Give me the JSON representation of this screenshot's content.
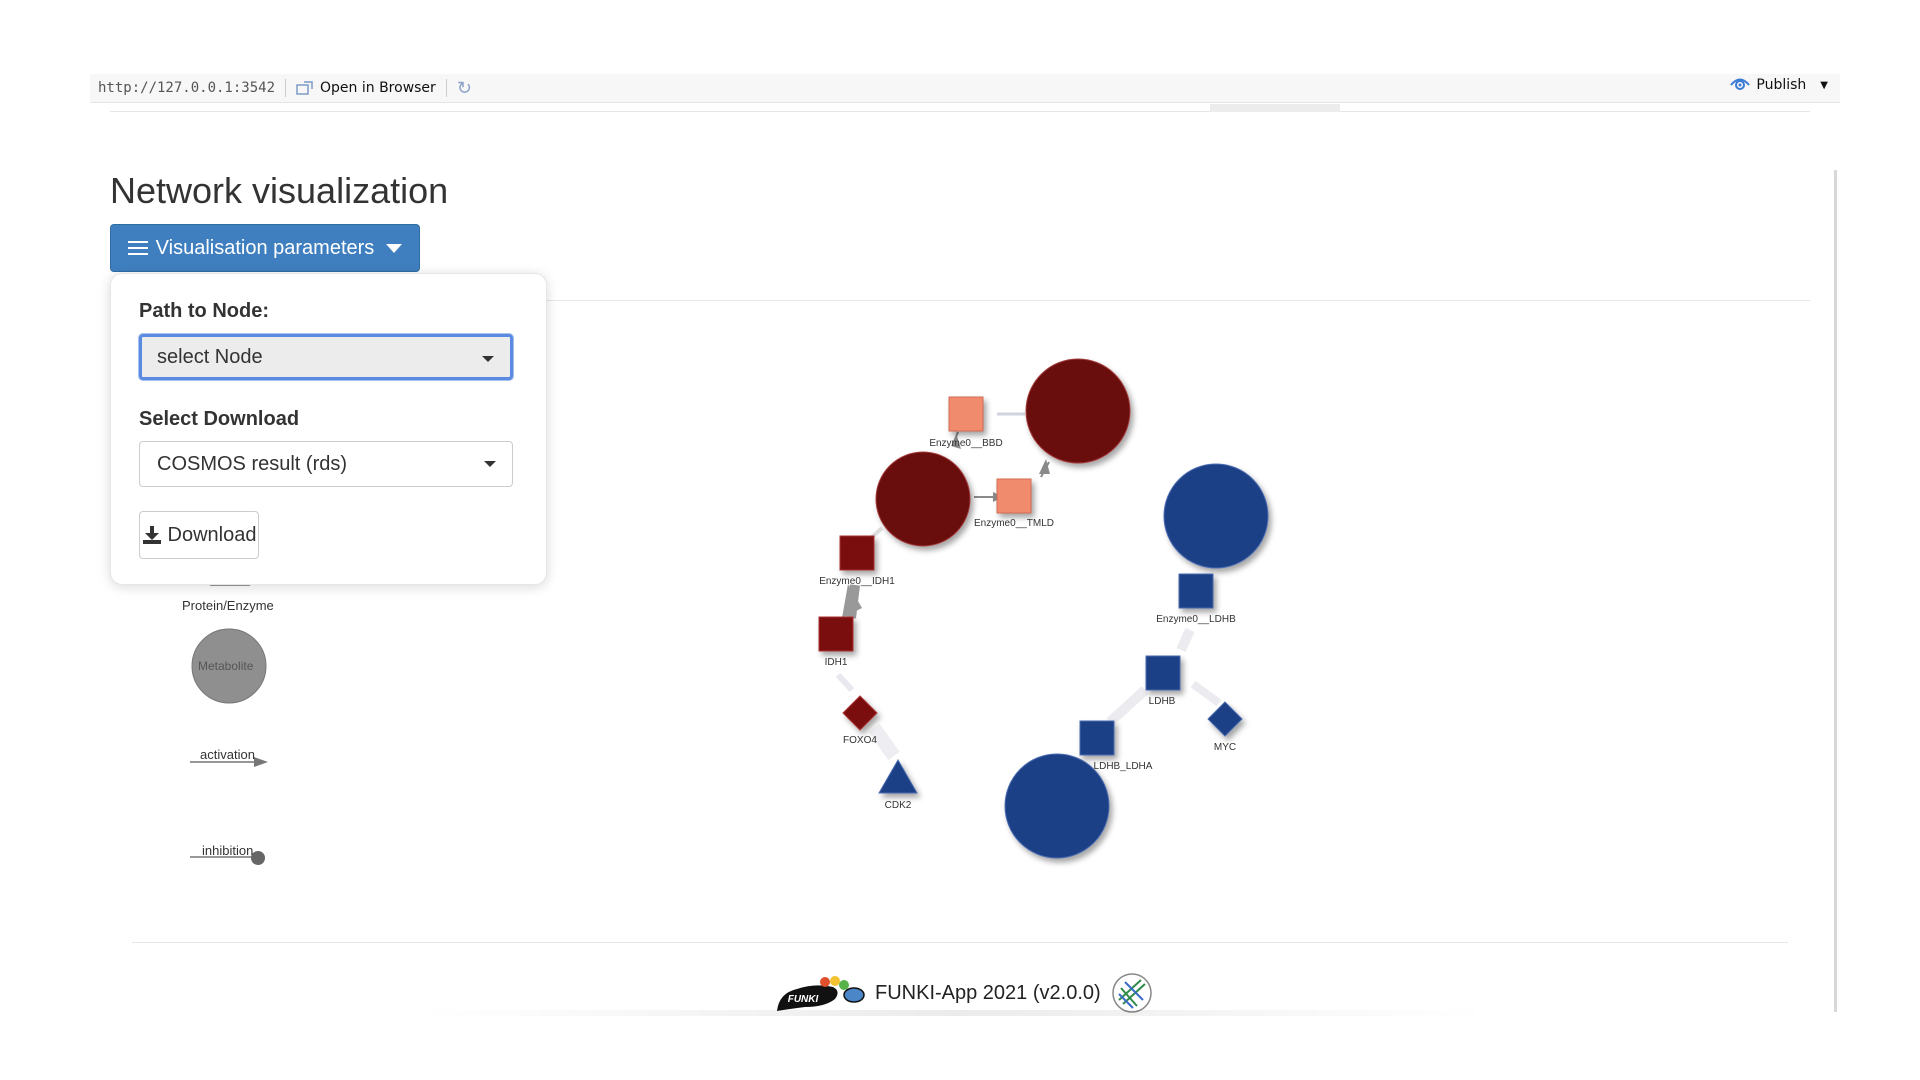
{
  "browser_bar": {
    "url": "http://127.0.0.1:3542",
    "open_in_browser": "Open in Browser",
    "publish": "Publish"
  },
  "page": {
    "title": "Network visualization",
    "params_button": "Visualisation parameters"
  },
  "panel": {
    "path_label": "Path to Node:",
    "path_select_value": "select Node",
    "download_label": "Select Download",
    "download_select_value": "COSMOS result (rds)",
    "download_button": "Download"
  },
  "legend": {
    "protein": "Protein/Enzyme",
    "metabolite": "Metabolite",
    "activation": "activation",
    "inhibition": "inhibition"
  },
  "network": {
    "nodes": [
      {
        "label": "Enzyme0__BBD",
        "shape": "square",
        "color": "#f08b6d"
      },
      {
        "label": "Enzyme0__TMLD",
        "shape": "square",
        "color": "#f08b6d"
      },
      {
        "label": "Enzyme0__IDH1",
        "shape": "square",
        "color": "#7a1010"
      },
      {
        "label": "IDH1",
        "shape": "square",
        "color": "#7a1010"
      },
      {
        "label": "FOXO4",
        "shape": "diamond",
        "color": "#7a1010"
      },
      {
        "label": "CDK2",
        "shape": "triangle",
        "color": "#1f3f86"
      },
      {
        "label": "Enzyme0__LDHB",
        "shape": "square",
        "color": "#1f3f86"
      },
      {
        "label": "LDHB",
        "shape": "square",
        "color": "#1f3f86"
      },
      {
        "label": "MYC",
        "shape": "diamond",
        "color": "#1f3f86"
      },
      {
        "label": "LDHB_LDHA",
        "shape": "square",
        "color": "#1f3f86"
      }
    ],
    "colors": {
      "upregulated": "#7a1010",
      "downregulated": "#1f3f86",
      "enzyme_light": "#f08b6d"
    }
  },
  "footer": {
    "text": "FUNKI-App 2021 (v2.0.0)",
    "logo_text": "FUNKI"
  }
}
